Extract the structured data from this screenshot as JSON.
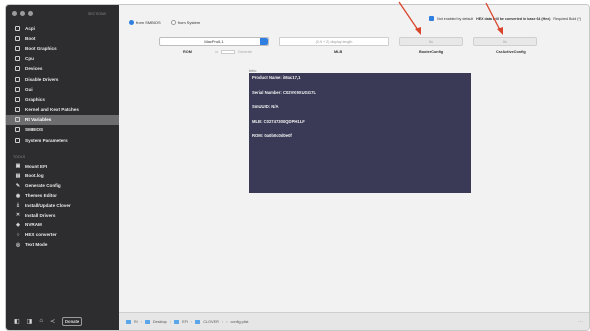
{
  "sidebar": {
    "header": "SECTIONS",
    "items": [
      {
        "label": "Acpi"
      },
      {
        "label": "Boot"
      },
      {
        "label": "Boot Graphics"
      },
      {
        "label": "Cpu"
      },
      {
        "label": "Devices"
      },
      {
        "label": "Disable Drivers"
      },
      {
        "label": "Gui"
      },
      {
        "label": "Graphics"
      },
      {
        "label": "Kernel and Kext Patches"
      },
      {
        "label": "Rt Variables"
      },
      {
        "label": "SMBIOS"
      },
      {
        "label": "System Parameters"
      }
    ],
    "selected_index": 9,
    "tools_header": "TOOLS",
    "tools": [
      {
        "label": "Mount EFI",
        "icon": "disk-icon"
      },
      {
        "label": "Boot.log",
        "icon": "document-icon"
      },
      {
        "label": "Generate Config",
        "icon": "wrench-icon"
      },
      {
        "label": "Themes Editor",
        "icon": "palette-icon"
      },
      {
        "label": "Install/Update Clover",
        "icon": "download-icon"
      },
      {
        "label": "Install Drivers",
        "icon": "cross-icon"
      },
      {
        "label": "NVRAM",
        "icon": "chip-icon"
      },
      {
        "label": "HEX converter",
        "icon": "cycle-icon"
      },
      {
        "label": "Text Mode",
        "icon": "text-icon"
      }
    ],
    "bottom_button": "Donate"
  },
  "main": {
    "radio_from_smbios": "from SMBIOS",
    "radio_from_system": "from System",
    "hex_note_prefix": "Not enabled by default",
    "hex_note_bold": "HEX data will be converted in base 64 (Hex)",
    "hex_note_suffix": "Required Bold (*)",
    "select_value": "MacPro6,1",
    "textbox_placeholder": "(0-9 + Z) display length",
    "pill_left": "0x",
    "pill_right": "0x",
    "label_rom": "ROM",
    "label_mlb": "MLB",
    "label_bootercfg": "BooterConfig",
    "label_csractive": "CsrActiveConfig",
    "rom_mini_text": "or",
    "rom_mini_text2": "Generate",
    "info_label": "Info:",
    "info_lines": [
      "Product Name: iMac17,1",
      "Serial Number: C02VK9XUGG7L",
      "SmUUID: N/A",
      "MLB: C02747300QDPH1LF",
      "ROM: 0a0b0c0d0e0f"
    ]
  },
  "path_bar": {
    "segments": [
      "Ri",
      "Desktop",
      "EFI",
      "CLOVER",
      "config.plist"
    ]
  },
  "colors": {
    "sidebar_bg": "#2d2d2f",
    "accent": "#2f7fe0",
    "info_panel_bg": "#3a3a57",
    "arrow": "#d9452b"
  }
}
